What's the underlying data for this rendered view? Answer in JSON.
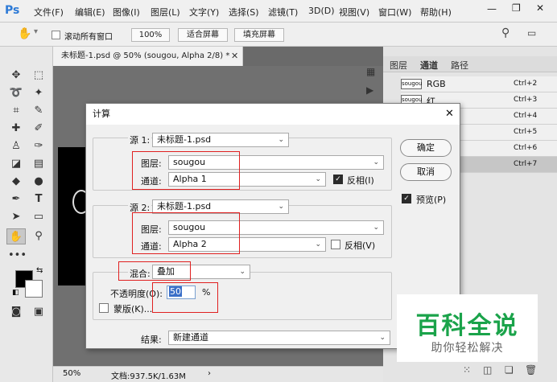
{
  "app": {
    "logo": "Ps",
    "menus": [
      "文件(F)",
      "编辑(E)",
      "图像(I)",
      "图层(L)",
      "文字(Y)",
      "选择(S)",
      "滤镜(T)",
      "3D(D)",
      "视图(V)",
      "窗口(W)",
      "帮助(H)"
    ]
  },
  "options": {
    "scroll_all": "滚动所有窗口",
    "zoom": "100%",
    "fit_screen": "适合屏幕",
    "fill_screen": "填充屏幕"
  },
  "document": {
    "tab_title": "未标题-1.psd @ 50% (sougou, Alpha 2/8) *",
    "zoom": "50%",
    "doc_info": "文档:937.5K/1.63M"
  },
  "panels": {
    "tabs": [
      "图层",
      "通道",
      "路径"
    ],
    "channels": [
      {
        "name": "RGB",
        "thumb": "sougou",
        "shortcut": "Ctrl+2"
      },
      {
        "name": "红",
        "thumb": "sougou",
        "shortcut": "Ctrl+3"
      },
      {
        "name": "",
        "thumb": "",
        "shortcut": "Ctrl+4"
      },
      {
        "name": "",
        "thumb": "",
        "shortcut": "Ctrl+5"
      },
      {
        "name": "",
        "thumb": "",
        "shortcut": "Ctrl+6"
      },
      {
        "name": "",
        "thumb": "",
        "shortcut": "Ctrl+7"
      }
    ]
  },
  "dialog": {
    "title": "计算",
    "source1": {
      "label": "源 1:",
      "file": "未标题-1.psd",
      "layer_label": "图层:",
      "layer": "sougou",
      "channel_label": "通道:",
      "channel": "Alpha 1",
      "invert_label": "反相(I)",
      "invert": true
    },
    "source2": {
      "label": "源 2:",
      "file": "未标题-1.psd",
      "layer_label": "图层:",
      "layer": "sougou",
      "channel_label": "通道:",
      "channel": "Alpha 2",
      "invert_label": "反相(V)",
      "invert": false
    },
    "blend": {
      "label": "混合:",
      "mode": "叠加",
      "opacity_label": "不透明度(O):",
      "opacity": "50",
      "unit": "%",
      "mask_label": "蒙版(K)..."
    },
    "result": {
      "label": "结果:",
      "value": "新建通道"
    },
    "ok": "确定",
    "cancel": "取消",
    "preview": "预览(P)",
    "preview_on": true
  },
  "watermark": {
    "title": "百科全说",
    "subtitle": "助你轻松解决"
  }
}
